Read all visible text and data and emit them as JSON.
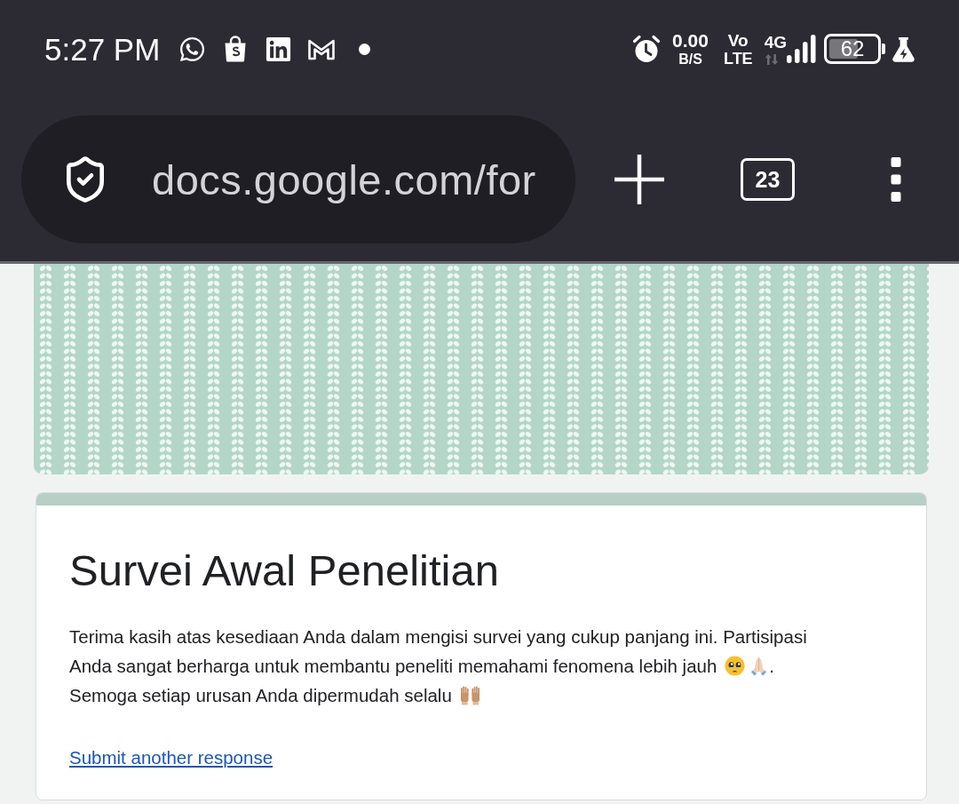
{
  "status_bar": {
    "time": "5:27 PM",
    "net_speed": "0.00",
    "net_speed_unit": "B/S",
    "volte_top": "Vo",
    "volte_bottom": "LTE",
    "network_type": "4G",
    "battery_percent": "62"
  },
  "browser_toolbar": {
    "url": "docs.google.com/for",
    "tab_count": "23"
  },
  "form": {
    "title": "Survei Awal Penelitian",
    "description": [
      {
        "text": "Terima kasih atas kesediaan Anda dalam mengisi survei yang cukup panjang ini. Partisipasi"
      },
      {
        "text": "Anda sangat berharga untuk membantu peneliti memahami fenomena lebih jauh",
        "end": "."
      },
      {
        "text": "Semoga setiap urusan Anda dipermudah selalu"
      }
    ],
    "link": "Submit another response"
  }
}
